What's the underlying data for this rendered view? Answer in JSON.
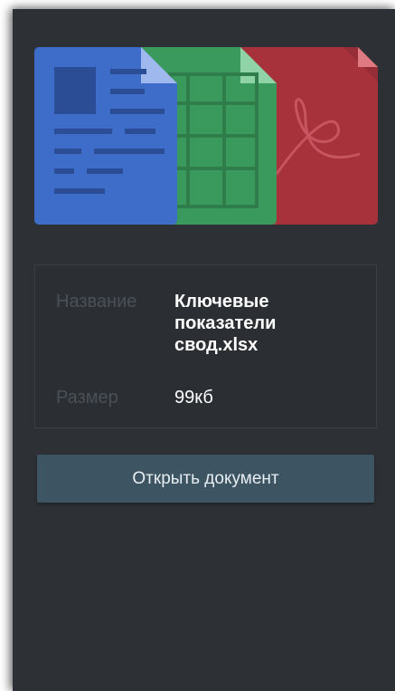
{
  "file_info": {
    "name_label": "Название",
    "name_value": "Ключевые показатели свод.xlsx",
    "size_label": "Размер",
    "size_value": "99кб"
  },
  "actions": {
    "open_button_label": "Открыть документ"
  },
  "icons": {
    "document": "text-document-icon",
    "spreadsheet": "spreadsheet-icon",
    "pdf": "pdf-icon"
  },
  "colors": {
    "background": "#2d3136",
    "doc_blue": "#3d6cc9",
    "sheet_green": "#3a9a5e",
    "pdf_red": "#a7323c",
    "button": "#3d5463"
  }
}
